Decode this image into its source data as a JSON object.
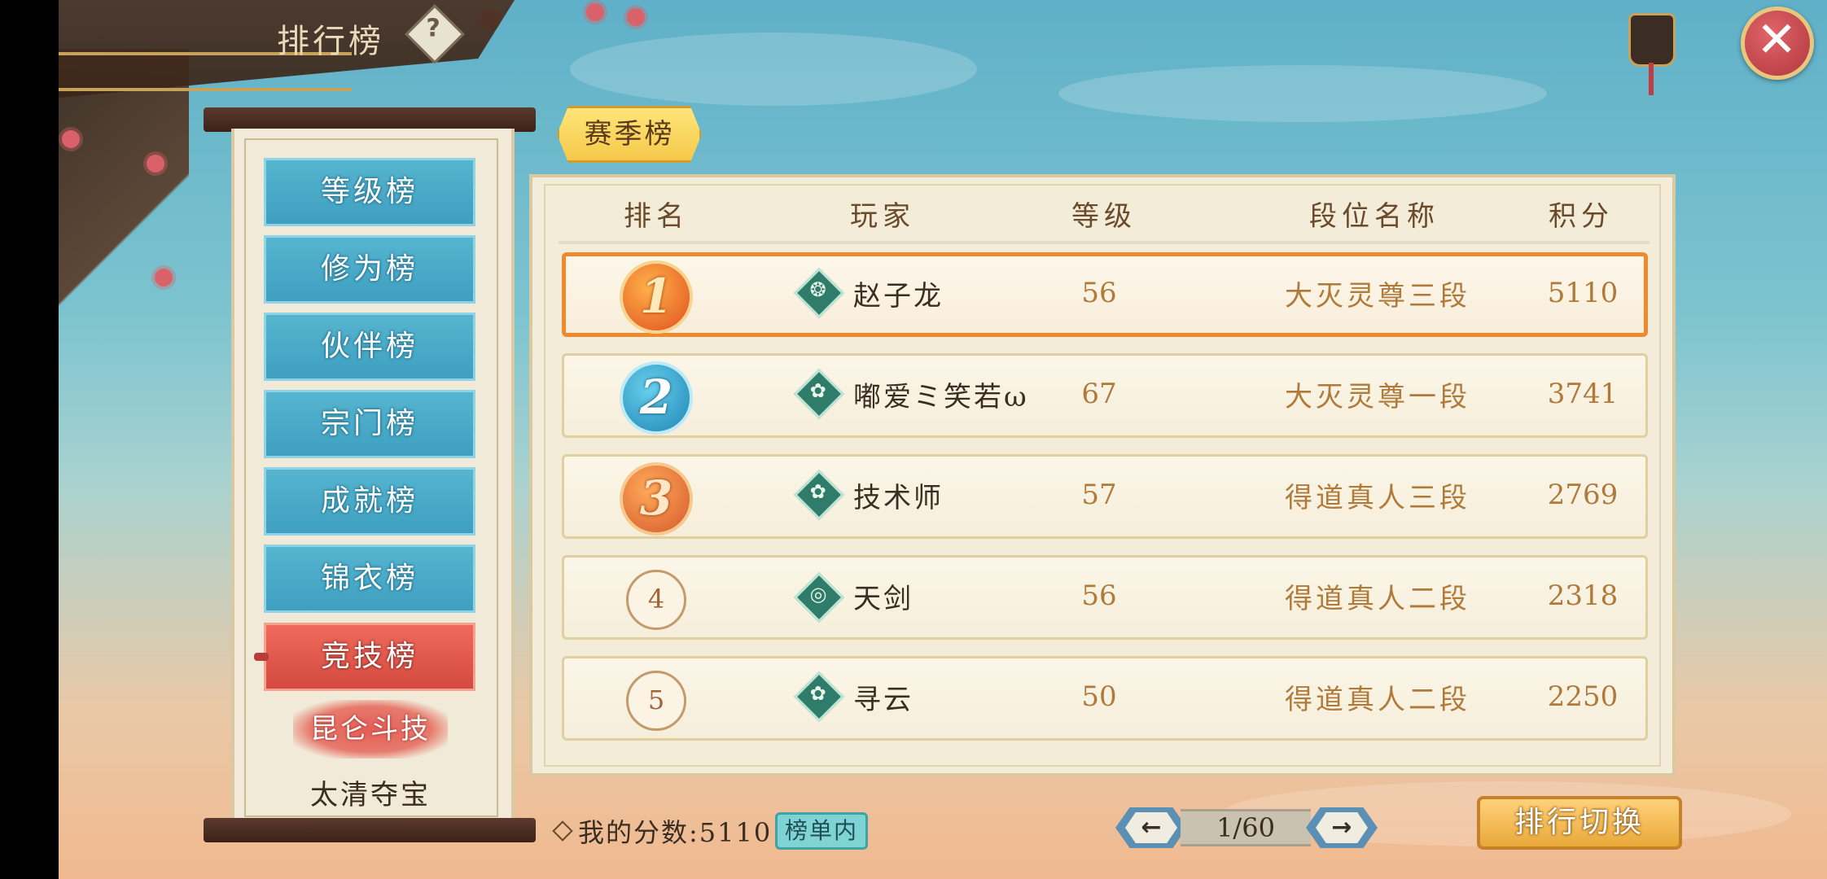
{
  "header": {
    "title": "排行榜",
    "help_icon": "question-icon",
    "close_icon": "close-icon"
  },
  "sidebar": {
    "items": [
      {
        "label": "等级榜",
        "active": false
      },
      {
        "label": "修为榜",
        "active": false
      },
      {
        "label": "伙伴榜",
        "active": false
      },
      {
        "label": "宗门榜",
        "active": false
      },
      {
        "label": "成就榜",
        "active": false
      },
      {
        "label": "锦衣榜",
        "active": false
      },
      {
        "label": "竞技榜",
        "active": true
      }
    ],
    "sub_items": [
      {
        "label": "昆仑斗技",
        "active": true
      },
      {
        "label": "太清夺宝",
        "active": false
      }
    ]
  },
  "season_tab": {
    "label": "赛季榜"
  },
  "table": {
    "columns": [
      "排名",
      "玩家",
      "等级",
      "段位名称",
      "积分"
    ],
    "rows": [
      {
        "rank": "1",
        "player": "赵子龙",
        "emblem": "dragon-emblem-icon",
        "level": "56",
        "tier": "大灭灵尊三段",
        "score": "5110"
      },
      {
        "rank": "2",
        "player": "嘟爱ミ笑若ω",
        "emblem": "butterfly-emblem-icon",
        "level": "67",
        "tier": "大灭灵尊一段",
        "score": "3741"
      },
      {
        "rank": "3",
        "player": "技术师",
        "emblem": "butterfly-emblem-icon",
        "level": "57",
        "tier": "得道真人三段",
        "score": "2769"
      },
      {
        "rank": "4",
        "player": "天剑",
        "emblem": "swirl-emblem-icon",
        "level": "56",
        "tier": "得道真人二段",
        "score": "2318"
      },
      {
        "rank": "5",
        "player": "寻云",
        "emblem": "butterfly-emblem-icon",
        "level": "50",
        "tier": "得道真人二段",
        "score": "2250"
      }
    ]
  },
  "footer": {
    "my_score_label": "我的分数:5110",
    "in_list_badge": "榜单内",
    "pager": {
      "text": "1/60",
      "prev_icon": "arrow-left-icon",
      "next_icon": "arrow-right-icon"
    },
    "switch_button": "排行切换"
  }
}
